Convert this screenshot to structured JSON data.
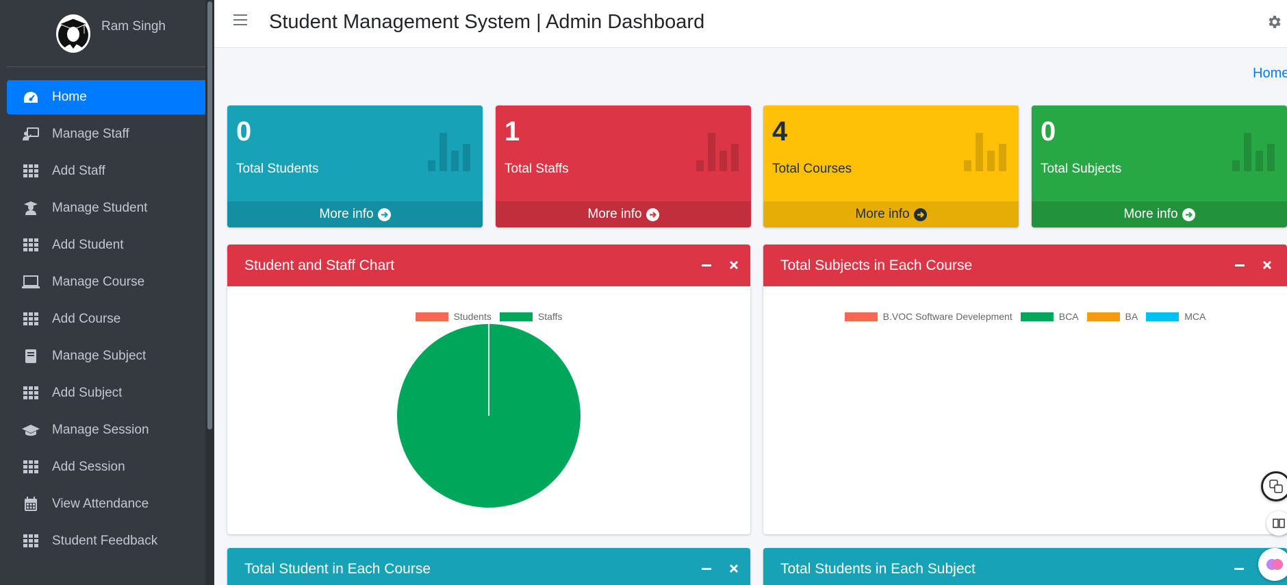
{
  "user": {
    "name": "Ram Singh"
  },
  "header": {
    "title": "Student Management System | Admin Dashboard"
  },
  "breadcrumb": {
    "home": "Home"
  },
  "sidebar": {
    "items": [
      {
        "label": "Home",
        "icon": "dashboard-icon",
        "active": true
      },
      {
        "label": "Manage Staff",
        "icon": "chalkboard-teacher-icon"
      },
      {
        "label": "Add Staff",
        "icon": "grid-icon"
      },
      {
        "label": "Manage Student",
        "icon": "user-graduate-icon"
      },
      {
        "label": "Add Student",
        "icon": "grid-icon"
      },
      {
        "label": "Manage Course",
        "icon": "laptop-icon"
      },
      {
        "label": "Add Course",
        "icon": "grid-icon"
      },
      {
        "label": "Manage Subject",
        "icon": "book-icon"
      },
      {
        "label": "Add Subject",
        "icon": "grid-icon"
      },
      {
        "label": "Manage Session",
        "icon": "graduation-cap-icon"
      },
      {
        "label": "Add Session",
        "icon": "grid-icon"
      },
      {
        "label": "View Attendance",
        "icon": "calendar-icon"
      },
      {
        "label": "Student Feedback",
        "icon": "grid-icon"
      }
    ]
  },
  "stats": [
    {
      "value": "0",
      "label": "Total Students",
      "more": "More info",
      "color": "#17a2b8"
    },
    {
      "value": "1",
      "label": "Total Staffs",
      "more": "More info",
      "color": "#dc3545"
    },
    {
      "value": "4",
      "label": "Total Courses",
      "more": "More info",
      "color": "#ffc107"
    },
    {
      "value": "0",
      "label": "Total Subjects",
      "more": "More info",
      "color": "#28a745"
    }
  ],
  "cards": {
    "student_staff": {
      "title": "Student and Staff Chart"
    },
    "subjects_course": {
      "title": "Total Subjects in Each Course"
    },
    "students_course": {
      "title": "Total Student in Each Course"
    },
    "students_subject": {
      "title": "Total Students in Each Subject"
    }
  },
  "chart_data": [
    {
      "type": "pie",
      "categories": [
        "Students",
        "Staffs"
      ],
      "values": [
        0,
        1
      ],
      "colors": [
        "#f56954",
        "#00a65a"
      ],
      "legend": "top"
    },
    {
      "type": "pie",
      "categories": [
        "B.VOC Software Develepment",
        "BCA",
        "BA",
        "MCA"
      ],
      "values": [
        0,
        0,
        0,
        0
      ],
      "colors": [
        "#f56954",
        "#00a65a",
        "#f39c12",
        "#00c0ef"
      ],
      "legend": "top"
    }
  ]
}
